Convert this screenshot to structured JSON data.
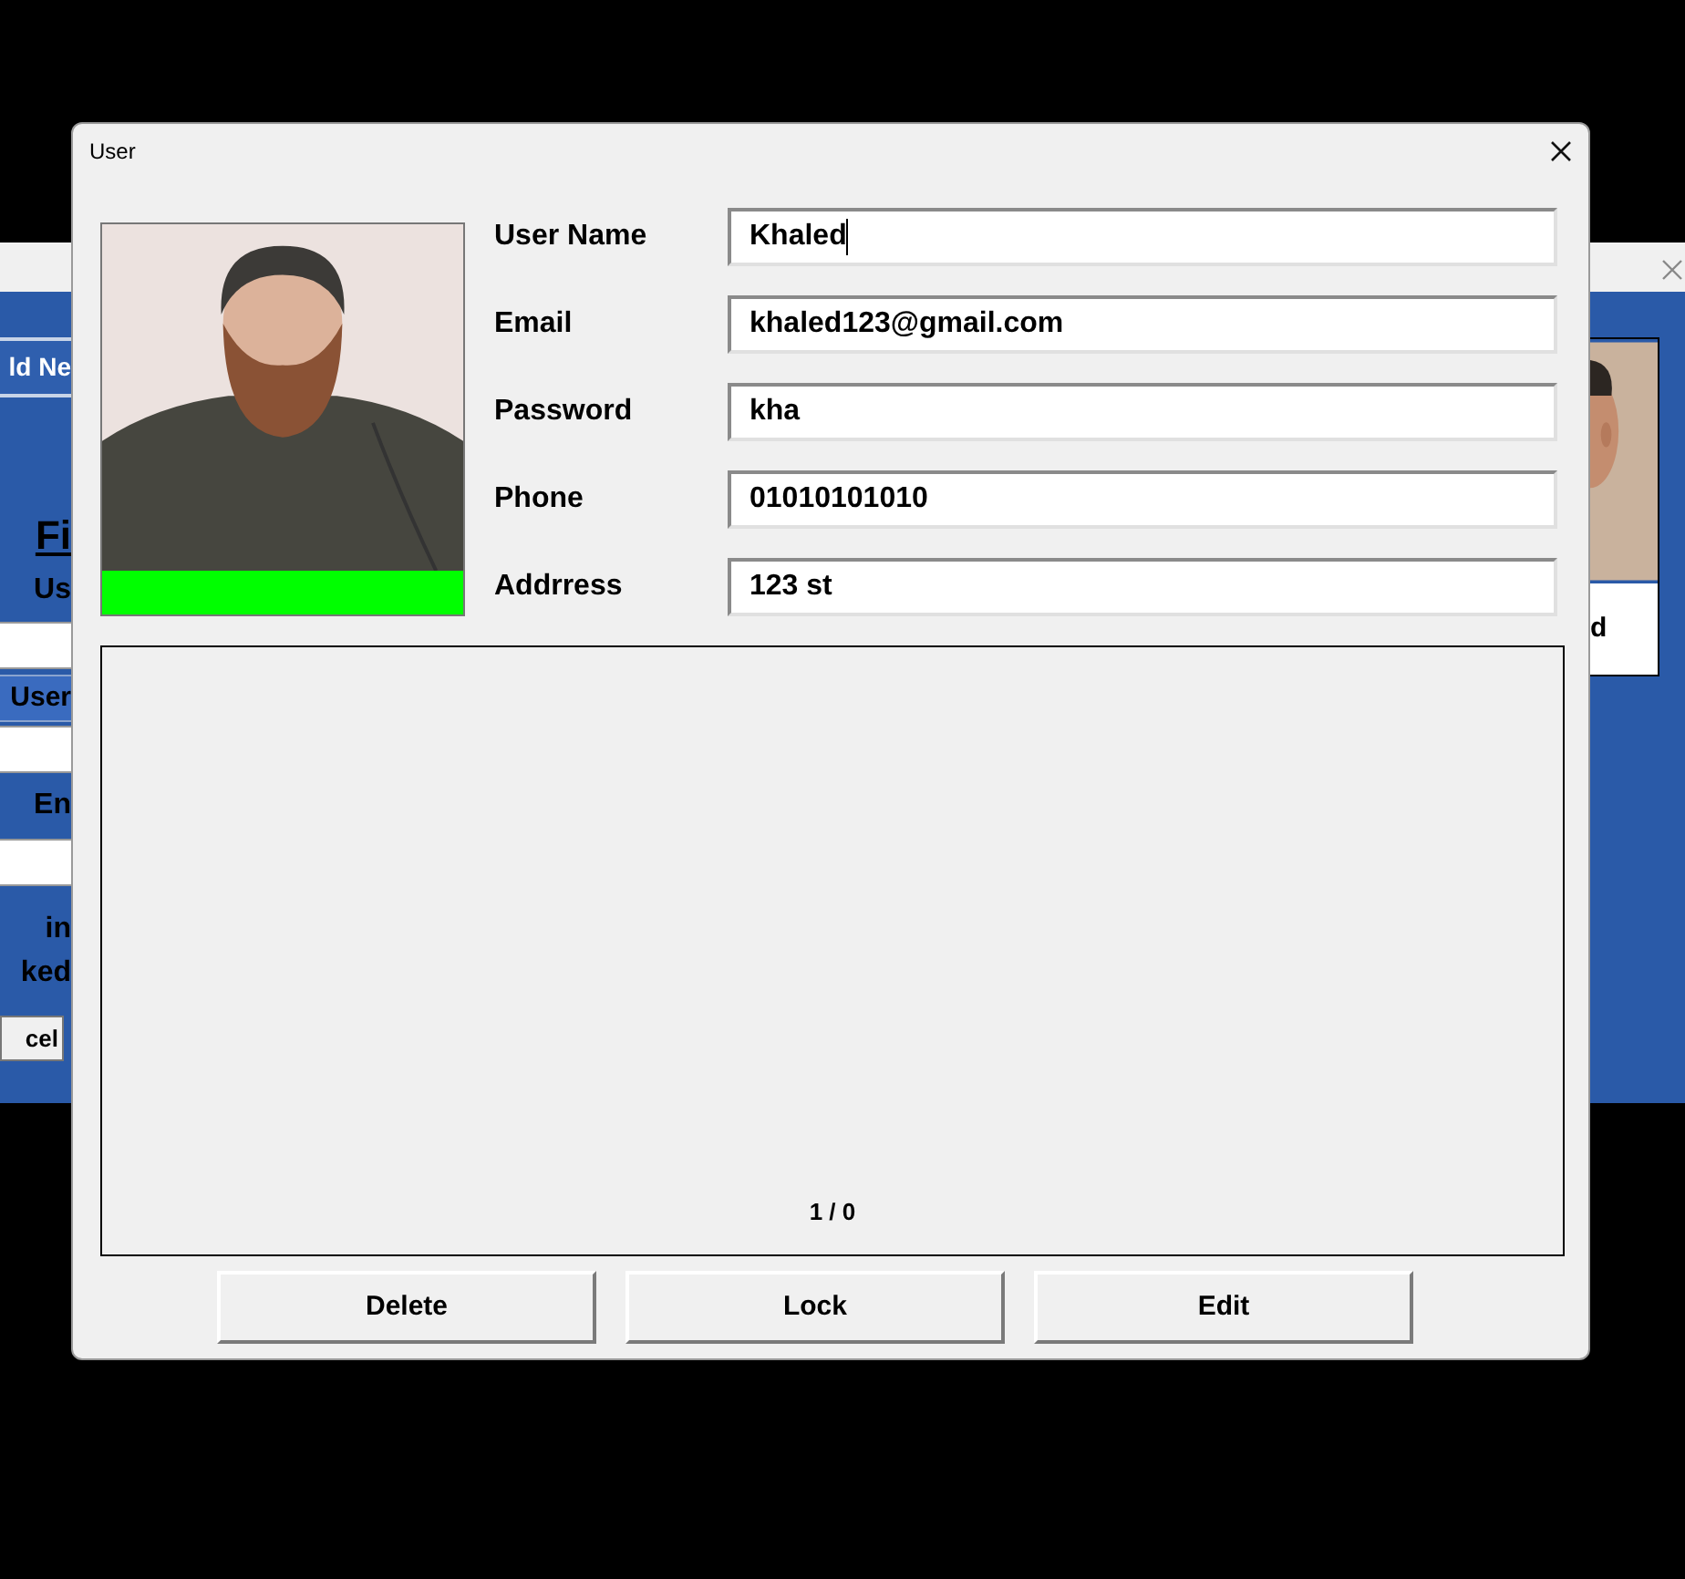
{
  "background_window": {
    "left_items": [
      {
        "kind": "button",
        "text": "ld Ne"
      },
      {
        "kind": "heading",
        "text": "Fi"
      },
      {
        "kind": "label",
        "text": "Us"
      },
      {
        "kind": "field"
      },
      {
        "kind": "bar",
        "text": "User"
      },
      {
        "kind": "field"
      },
      {
        "kind": "label",
        "text": "En"
      },
      {
        "kind": "field"
      },
      {
        "kind": "label",
        "text": "in"
      },
      {
        "kind": "label",
        "text": "ked"
      },
      {
        "kind": "button",
        "text": "cel"
      }
    ],
    "right_caption": "d"
  },
  "dialog": {
    "title": "User",
    "photo": {
      "color": "#00ff00"
    },
    "fields": [
      {
        "label": "User Name",
        "value": "Khaled",
        "focused": true
      },
      {
        "label": "Email",
        "value": "khaled123@gmail.com",
        "focused": false
      },
      {
        "label": "Password",
        "value": "kha",
        "focused": false
      },
      {
        "label": "Phone",
        "value": "01010101010",
        "focused": false
      },
      {
        "label": "Addrress",
        "value": "123 st",
        "focused": false
      }
    ],
    "list": {
      "counter": "1 / 0"
    },
    "buttons": [
      "Delete",
      "Lock",
      "Edit"
    ]
  }
}
